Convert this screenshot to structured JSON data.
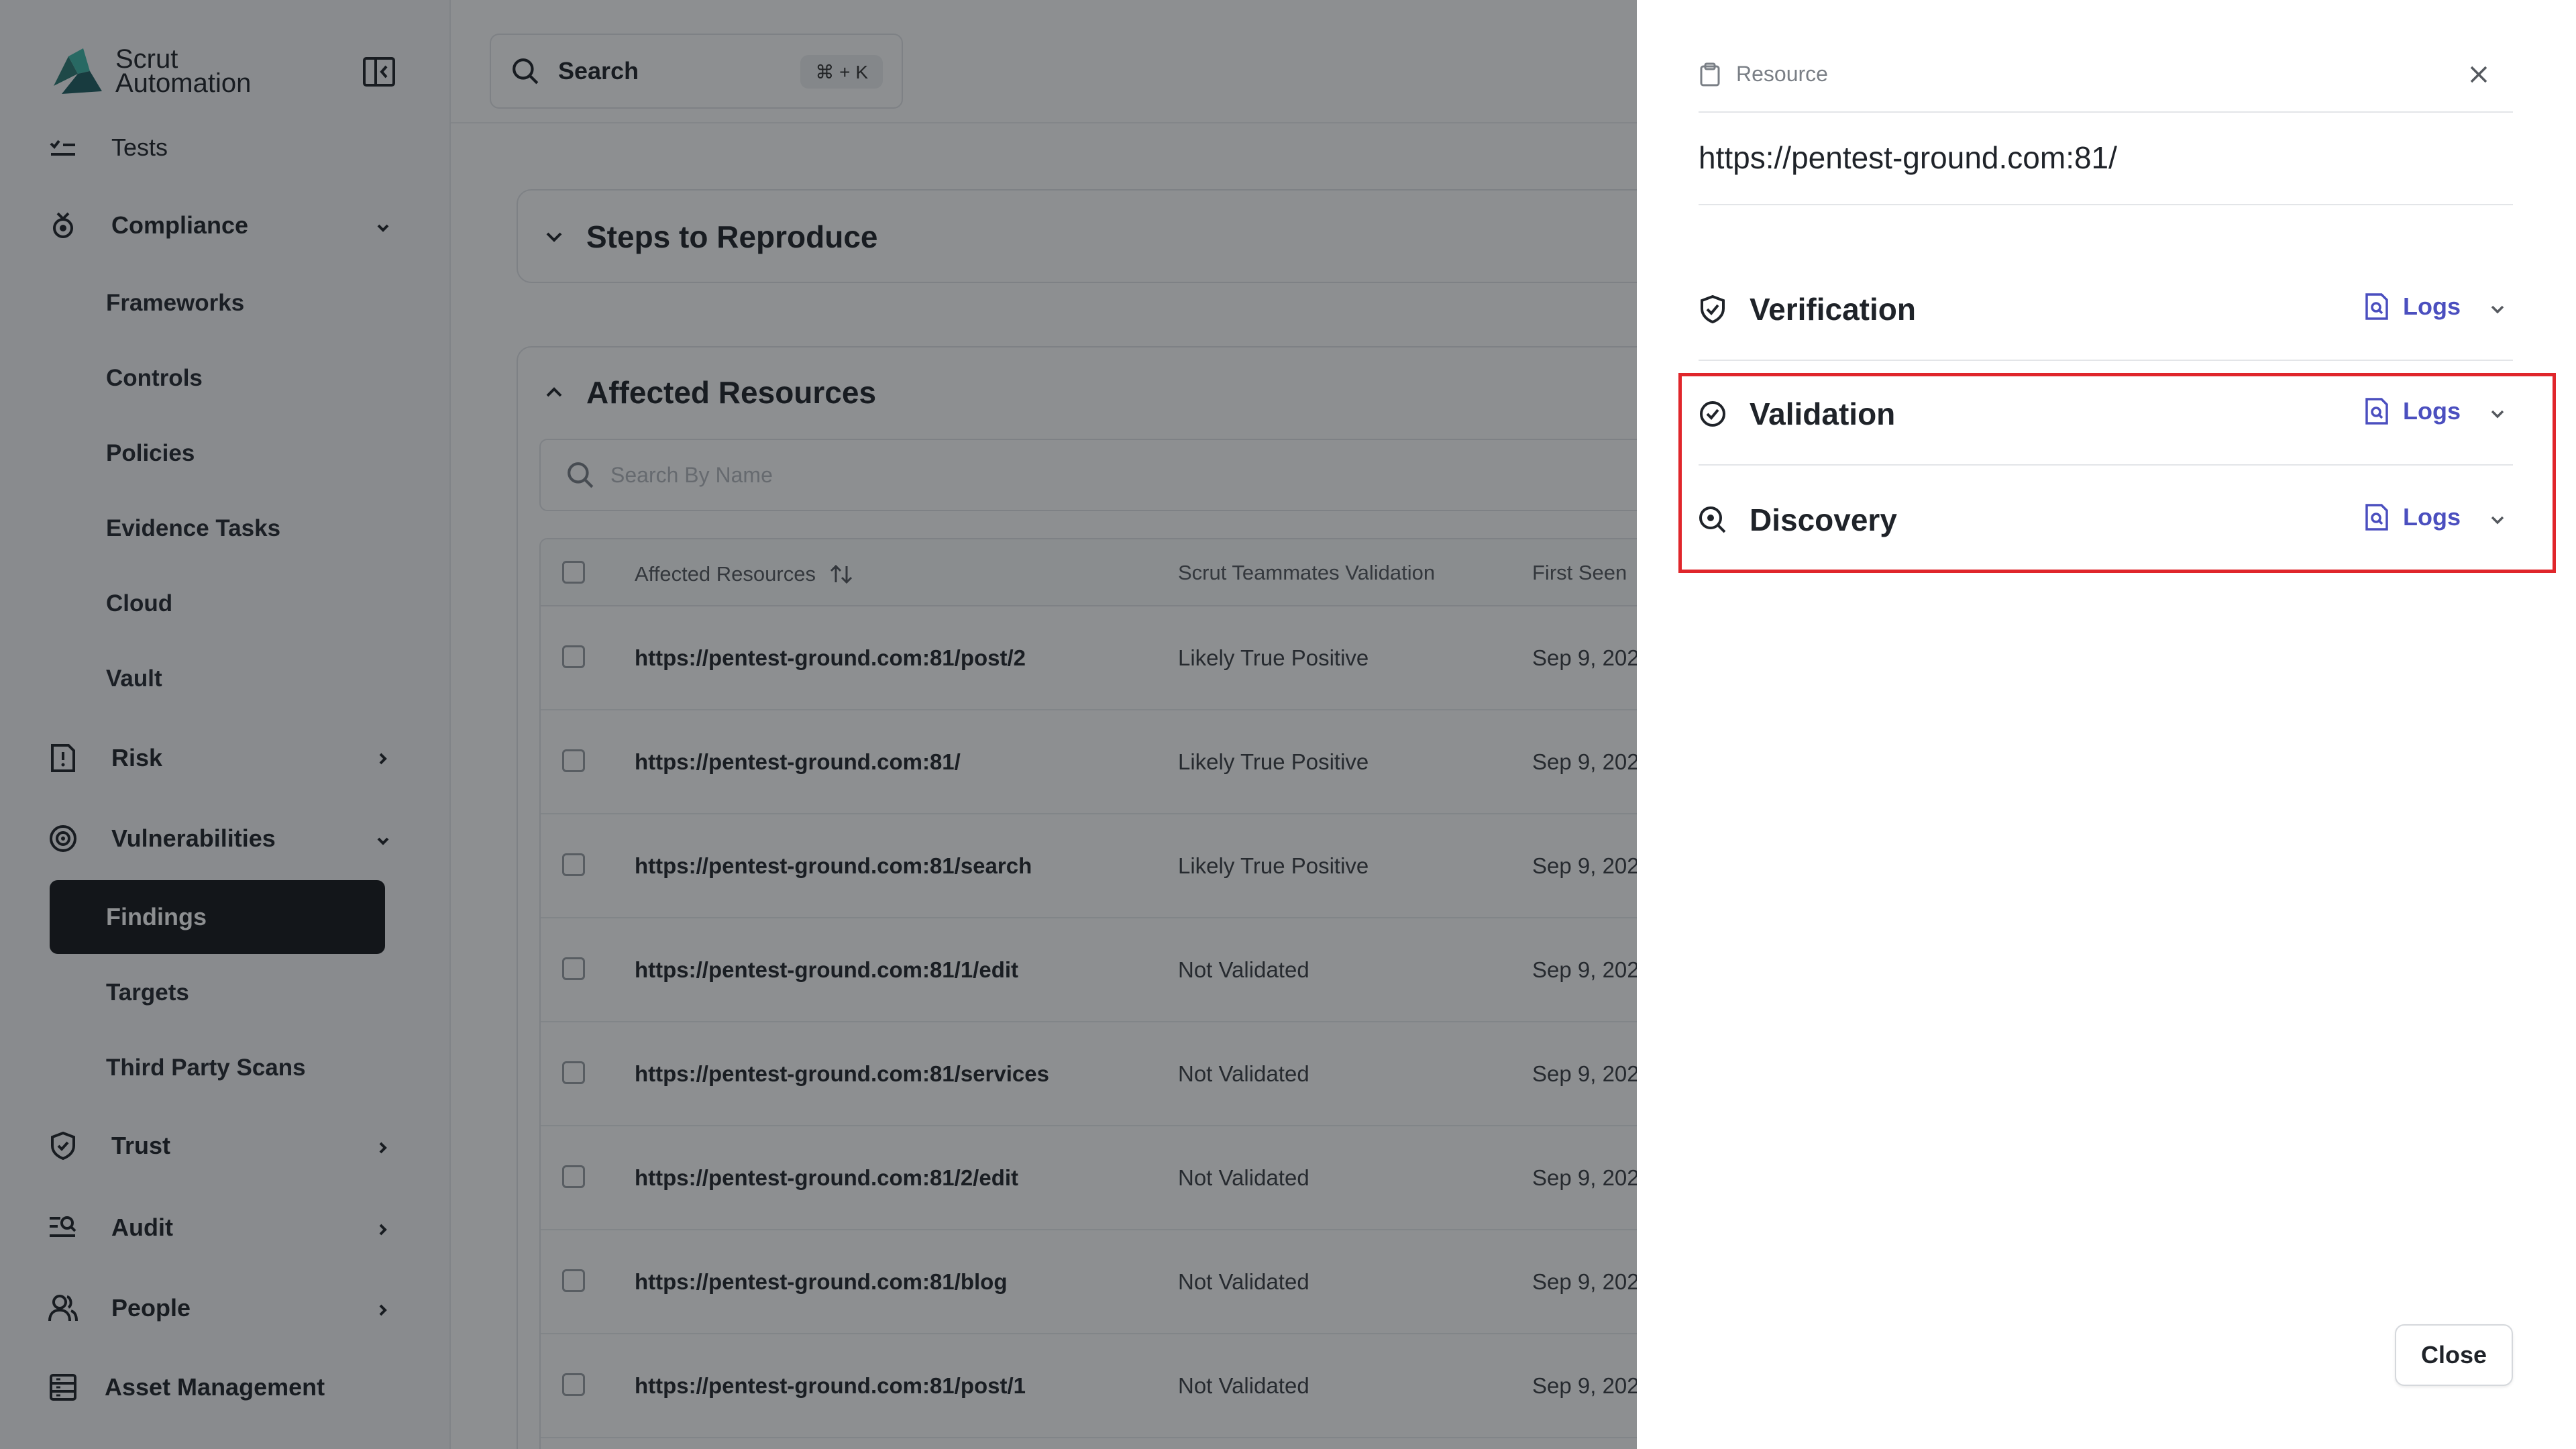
{
  "sidebar": {
    "brand": "Scrut Automation",
    "partial_item": "Tests",
    "compliance": "Compliance",
    "compliance_items": [
      "Frameworks",
      "Controls",
      "Policies",
      "Evidence Tasks",
      "Cloud",
      "Vault"
    ],
    "risk": "Risk",
    "vulnerabilities": "Vulnerabilities",
    "findings": "Findings",
    "targets": "Targets",
    "third_party_scans": "Third Party Scans",
    "trust": "Trust",
    "audit": "Audit",
    "people": "People",
    "asset_management": "Asset Management"
  },
  "search": {
    "label": "Search",
    "shortcut": "⌘ + K"
  },
  "main": {
    "steps_title": "Steps to Reproduce",
    "affected_title": "Affected Resources",
    "resource_search_placeholder": "Search By Name",
    "columns": [
      "Affected Resources",
      "Scrut Teammates Validation",
      "First Seen"
    ],
    "rows": [
      {
        "url": "https://pentest-ground.com:81/post/2",
        "validation": "Likely True Positive",
        "first_seen": "Sep 9, 202"
      },
      {
        "url": "https://pentest-ground.com:81/",
        "validation": "Likely True Positive",
        "first_seen": "Sep 9, 202"
      },
      {
        "url": "https://pentest-ground.com:81/search",
        "validation": "Likely True Positive",
        "first_seen": "Sep 9, 202"
      },
      {
        "url": "https://pentest-ground.com:81/1/edit",
        "validation": "Not Validated",
        "first_seen": "Sep 9, 202"
      },
      {
        "url": "https://pentest-ground.com:81/services",
        "validation": "Not Validated",
        "first_seen": "Sep 9, 202"
      },
      {
        "url": "https://pentest-ground.com:81/2/edit",
        "validation": "Not Validated",
        "first_seen": "Sep 9, 202"
      },
      {
        "url": "https://pentest-ground.com:81/blog",
        "validation": "Not Validated",
        "first_seen": "Sep 9, 202"
      },
      {
        "url": "https://pentest-ground.com:81/post/1",
        "validation": "Not Validated",
        "first_seen": "Sep 9, 202"
      }
    ]
  },
  "drawer": {
    "header": "Resource",
    "url": "https://pentest-ground.com:81/",
    "sections": [
      {
        "title": "Verification",
        "logs": "Logs"
      },
      {
        "title": "Validation",
        "logs": "Logs"
      },
      {
        "title": "Discovery",
        "logs": "Logs"
      }
    ],
    "close_button": "Close"
  },
  "colors": {
    "accent": "#4b4fbf",
    "highlight": "#e0262b",
    "active_nav_bg": "#16181c",
    "brand_teal": "#2a9d8f"
  }
}
